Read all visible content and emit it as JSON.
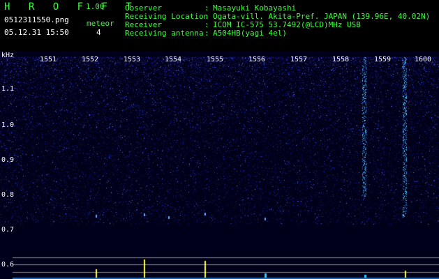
{
  "header": {
    "app_name": "H R O F F T",
    "version": "1.00",
    "filename": "0512311550.png",
    "datetime": "05.12.31 15:50",
    "meteor_label": "meteor",
    "meteor_count": "4"
  },
  "info": [
    {
      "label": "Observer",
      "value": "Masayuki Kobayashi"
    },
    {
      "label": "Receiving Location",
      "value": "Ogata-vill. Akita-Pref. JAPAN (139.96E, 40.02N)"
    },
    {
      "label": "Receiver",
      "value": "ICOM IC-575 53.7492(@LCD)MHz USB"
    },
    {
      "label": "Receiving antenna",
      "value": "A504HB(yagi 4el)"
    }
  ],
  "plot": {
    "y_unit": "kHz",
    "time_ticks": [
      "1551",
      "1552",
      "1553",
      "1554",
      "1555",
      "1556",
      "1557",
      "1558",
      "1559",
      "1600"
    ],
    "freq_ticks": [
      "1.1",
      "1.0",
      "0.9",
      "0.8",
      "0.7",
      "0.6"
    ]
  },
  "colors": {
    "text_green": "#39ff3a",
    "text_white": "#ffffff",
    "background": "#000000",
    "signal_cyan": "#33ccff",
    "signal_yellow": "#ffff33"
  }
}
